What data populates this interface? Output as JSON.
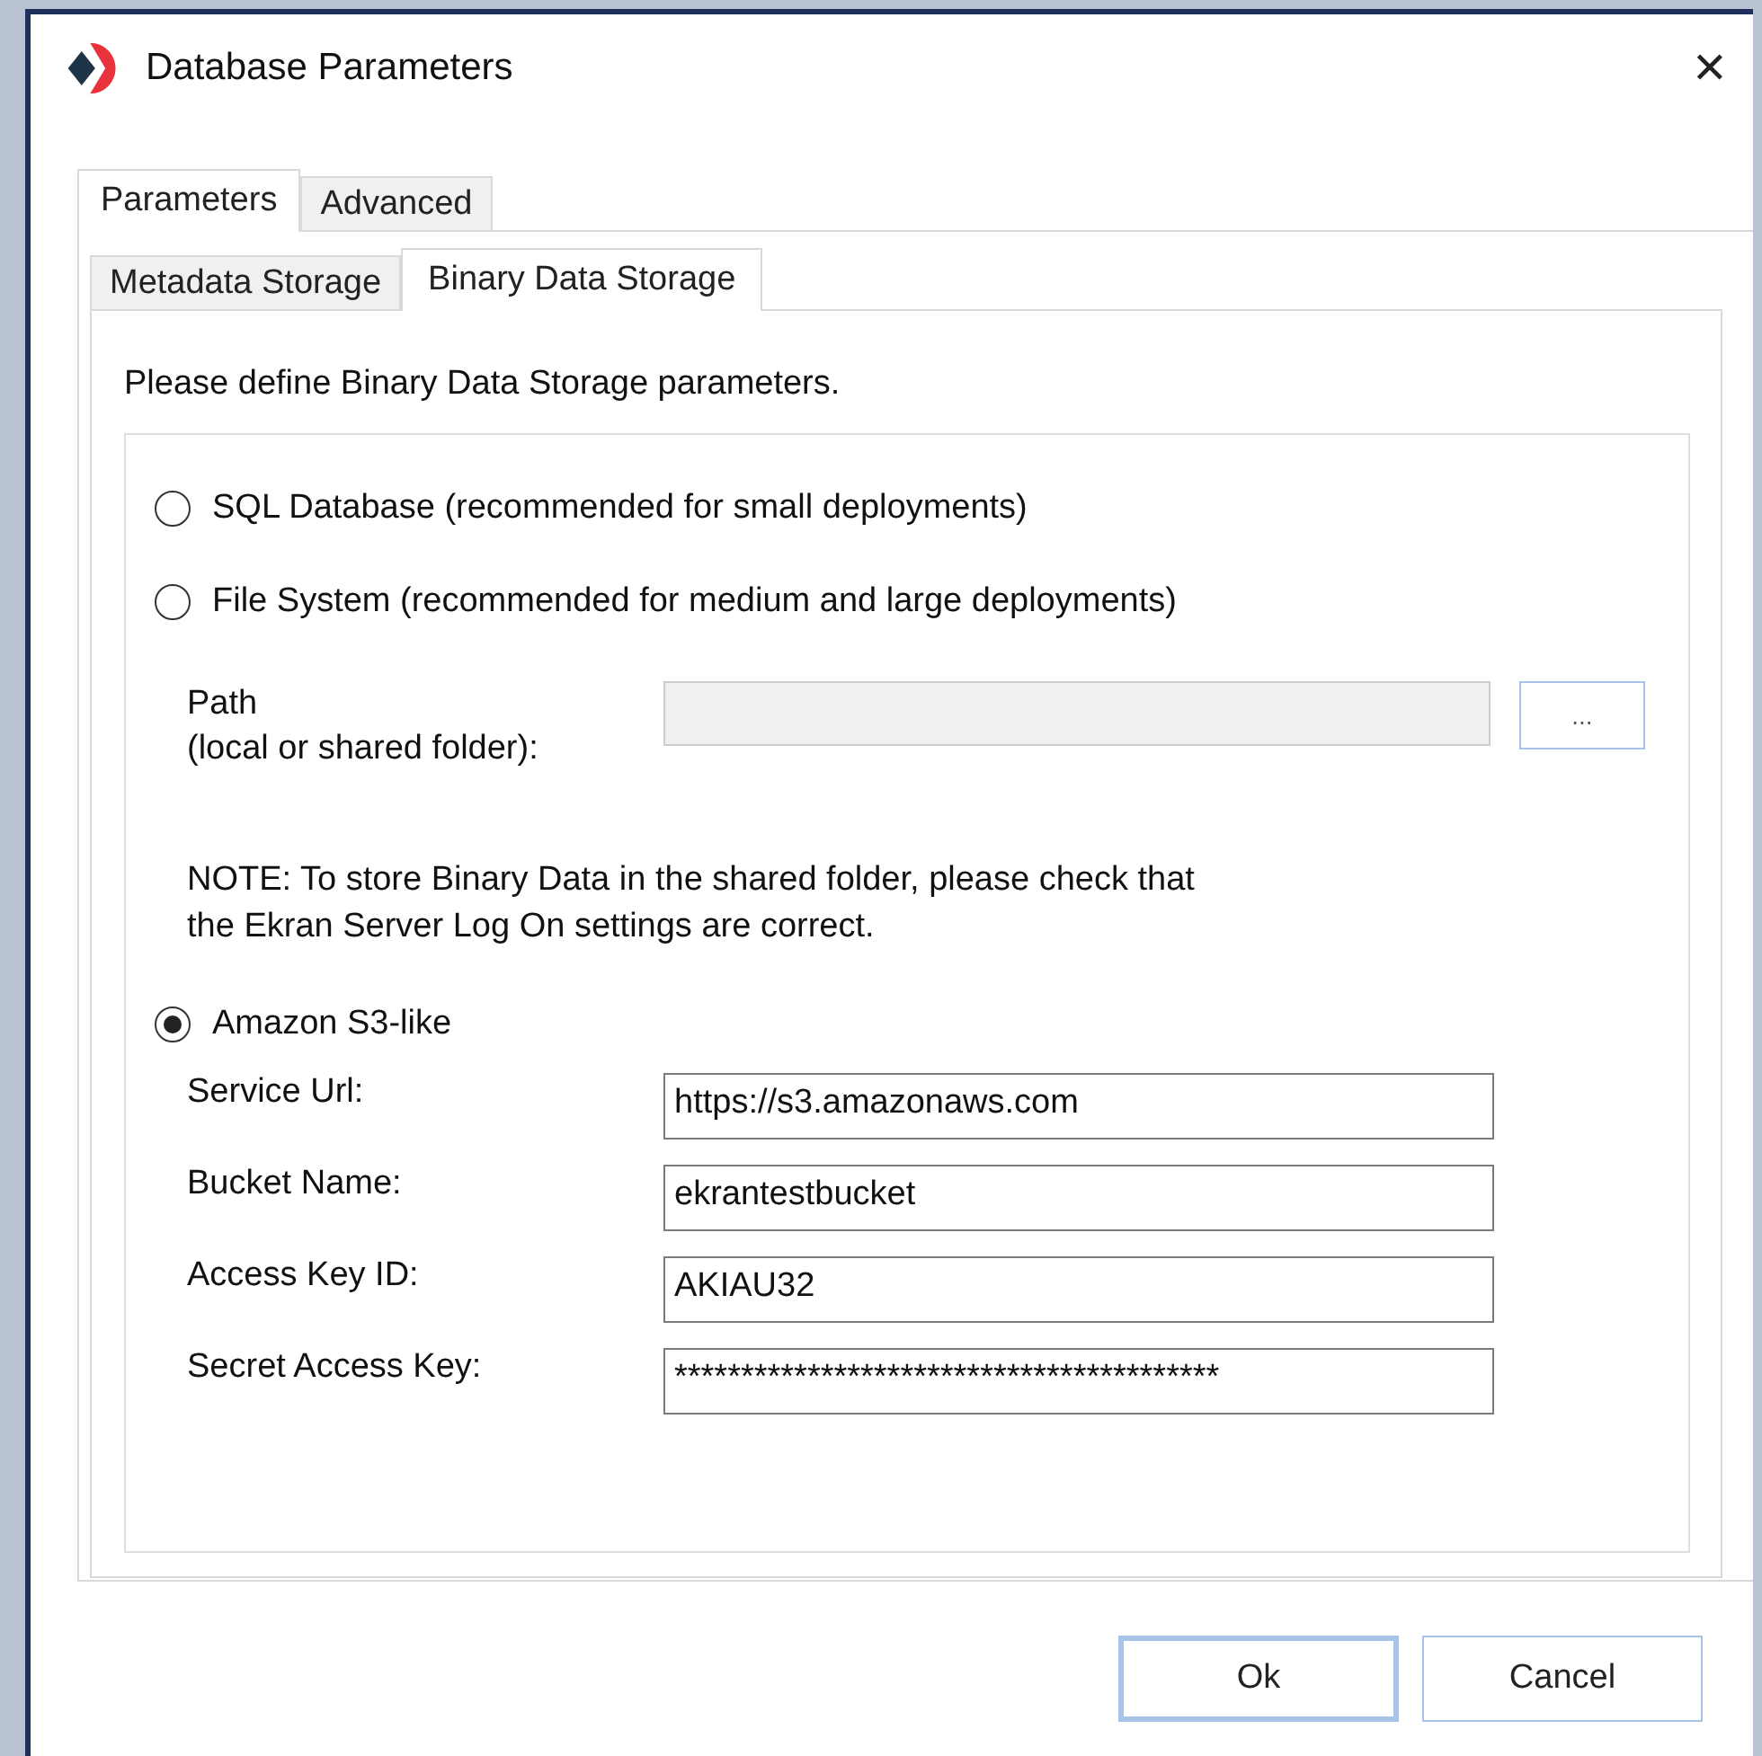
{
  "window": {
    "title": "Database Parameters",
    "close": "✕"
  },
  "tabs": [
    {
      "label": "Parameters",
      "selected": true
    },
    {
      "label": "Advanced",
      "selected": false
    }
  ],
  "subtabs": [
    {
      "label": "Metadata Storage",
      "selected": false
    },
    {
      "label": "Binary Data Storage",
      "selected": true
    }
  ],
  "description": "Please define Binary Data Storage parameters.",
  "storage_options": [
    {
      "label": "SQL Database (recommended for small deployments)",
      "selected": false
    },
    {
      "label": "File System (recommended for medium and large deployments)",
      "selected": false
    },
    {
      "label": "Amazon S3-like",
      "selected": true
    }
  ],
  "path": {
    "label_lines": [
      "Path",
      "(local or shared folder):"
    ],
    "disabled": true,
    "browse": "..."
  },
  "note_lines": [
    "NOTE: To store Binary Data in the shared folder, please check that",
    "the Ekran Server Log On settings are correct."
  ],
  "s3_fields": [
    {
      "label": "Service Url:",
      "value": "https://s3.amazonaws.com"
    },
    {
      "label": "Bucket Name:",
      "value": "ekrantestbucket"
    },
    {
      "label": "Access Key ID:",
      "value": "AKIAU32"
    },
    {
      "label": "Secret Access Key:",
      "value": "*****************************************"
    }
  ],
  "buttons": [
    {
      "label": "Ok",
      "default": true
    },
    {
      "label": "Cancel",
      "default": false
    }
  ]
}
